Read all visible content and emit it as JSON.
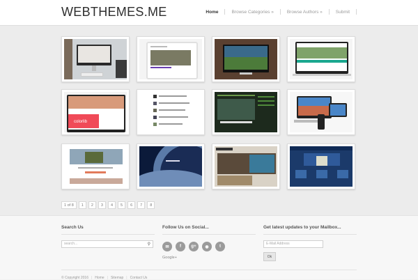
{
  "header": {
    "logo": "WEBTHEMES.ME",
    "nav": [
      {
        "label": "Home",
        "active": true
      },
      {
        "label": "Browse Categories »",
        "active": false
      },
      {
        "label": "Browse Authors »",
        "active": false
      },
      {
        "label": "Submit",
        "active": false
      }
    ]
  },
  "pagination": {
    "status": "1 of 8",
    "pages": [
      "1",
      "2",
      "3",
      "4",
      "5",
      "6",
      "7",
      "8"
    ]
  },
  "footer": {
    "search": {
      "title": "Search Us",
      "placeholder": "search..."
    },
    "social": {
      "title": "Follow Us on Social...",
      "icons": [
        "mail-icon",
        "facebook-icon",
        "google-plus-icon",
        "rss-icon",
        "twitter-icon"
      ],
      "glyphs": [
        "✉",
        "f",
        "g+",
        "◉",
        "t"
      ],
      "caption": "Google+"
    },
    "mailbox": {
      "title": "Get latest updates to your Mailbox...",
      "placeholder": "E-Mail Address",
      "button": "Ok"
    },
    "copyright": "© Copyright 2016",
    "links": [
      "Home",
      "Sitemap",
      "Contact Us"
    ]
  }
}
